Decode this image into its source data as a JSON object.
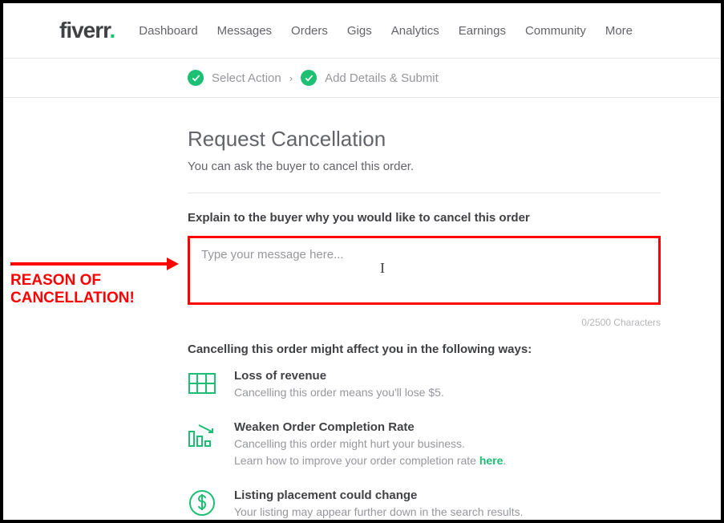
{
  "logo": {
    "text": "fiverr",
    "dot": "."
  },
  "nav": {
    "items": [
      "Dashboard",
      "Messages",
      "Orders",
      "Gigs",
      "Analytics",
      "Earnings",
      "Community",
      "More"
    ]
  },
  "steps": {
    "first": "Select Action",
    "second": "Add Details & Submit",
    "separator": "›"
  },
  "page": {
    "title": "Request Cancellation",
    "subtitle": "You can ask the buyer to cancel this order.",
    "explain_label": "Explain to the buyer why you would like to cancel this order",
    "placeholder": "Type your message here...",
    "counter": "0/2500 Characters",
    "effects_title": "Cancelling this order might affect you in the following ways:"
  },
  "effects": [
    {
      "title": "Loss of revenue",
      "desc": "Cancelling this order means you'll lose $5."
    },
    {
      "title": "Weaken Order Completion Rate",
      "desc1": "Cancelling this order might hurt your business.",
      "desc2_prefix": "Learn how to improve your order completion rate ",
      "desc2_link": "here",
      "desc2_suffix": "."
    },
    {
      "title": "Listing placement could change",
      "desc": "Your listing may appear further down in the search results."
    }
  ],
  "annotation": {
    "line1": "REASON OF",
    "line2": "CANCELLATION!"
  },
  "colors": {
    "accent": "#1dbf73",
    "annotation": "#ff0000"
  }
}
